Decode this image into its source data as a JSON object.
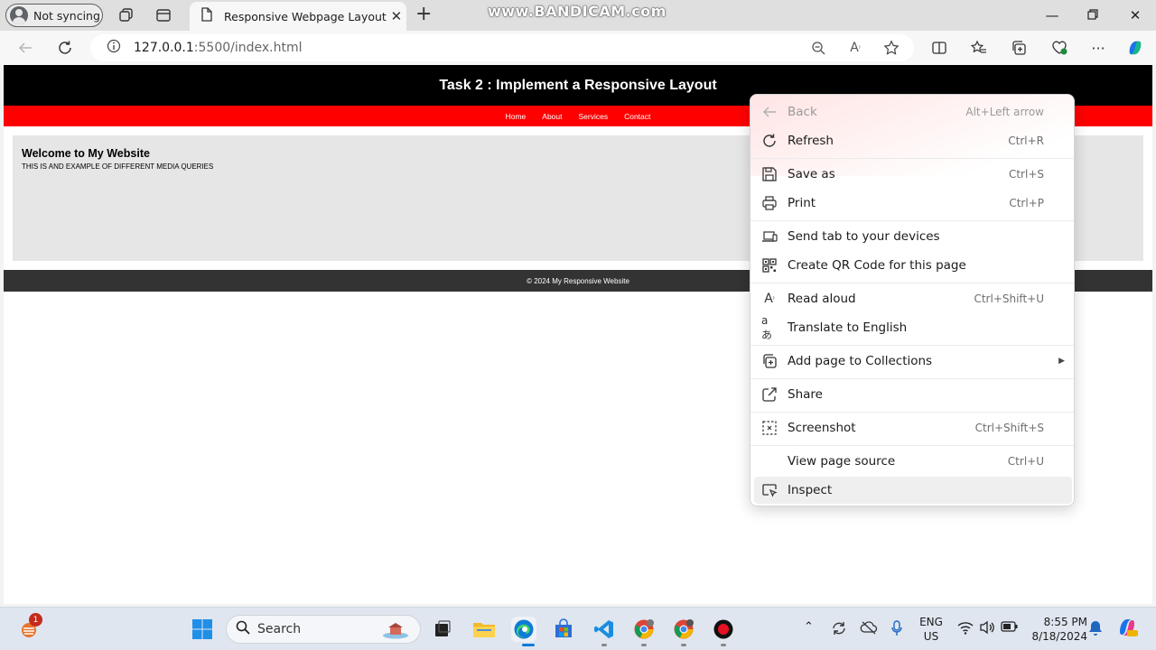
{
  "browser": {
    "profile_label": "Not syncing",
    "tab_title": "Responsive Webpage Layout",
    "watermark": "www.BANDICAM.com",
    "url_host": "127.0.0.1",
    "url_path": ":5500/index.html"
  },
  "page": {
    "header_title": "Task 2 : Implement a Responsive Layout",
    "nav": [
      "Home",
      "About",
      "Services",
      "Contact"
    ],
    "main_heading": "Welcome to My Website",
    "main_text": "THIS IS AND EXAMPLE OF DIFFERENT MEDIA QUERIES",
    "footer_text": "© 2024 My Responsive Website"
  },
  "context_menu": {
    "items": [
      {
        "label": "Back",
        "shortcut": "Alt+Left arrow",
        "icon": "back-arrow-icon",
        "disabled": true
      },
      {
        "label": "Refresh",
        "shortcut": "Ctrl+R",
        "icon": "refresh-icon"
      },
      {
        "label": "Save as",
        "shortcut": "Ctrl+S",
        "icon": "save-icon"
      },
      {
        "label": "Print",
        "shortcut": "Ctrl+P",
        "icon": "printer-icon"
      },
      {
        "label": "Send tab to your devices",
        "shortcut": "",
        "icon": "devices-icon"
      },
      {
        "label": "Create QR Code for this page",
        "shortcut": "",
        "icon": "qr-code-icon"
      },
      {
        "label": "Read aloud",
        "shortcut": "Ctrl+Shift+U",
        "icon": "read-aloud-icon"
      },
      {
        "label": "Translate to English",
        "shortcut": "",
        "icon": "translate-icon"
      },
      {
        "label": "Add page to Collections",
        "shortcut": "",
        "icon": "collections-icon",
        "submenu": true
      },
      {
        "label": "Share",
        "shortcut": "",
        "icon": "share-icon"
      },
      {
        "label": "Screenshot",
        "shortcut": "Ctrl+Shift+S",
        "icon": "screenshot-icon"
      },
      {
        "label": "View page source",
        "shortcut": "Ctrl+U",
        "icon": ""
      },
      {
        "label": "Inspect",
        "shortcut": "",
        "icon": "inspect-icon",
        "highlighted": true
      }
    ]
  },
  "taskbar": {
    "search_placeholder": "Search",
    "notification_badge": "1",
    "language_line1": "ENG",
    "language_line2": "US",
    "time": "8:55 PM",
    "date": "8/18/2024"
  },
  "colors": {
    "site_header": "#000000",
    "site_nav": "#ff0000",
    "site_main": "#e6e6e6",
    "site_footer": "#333333",
    "edge_blue": "#0078d4"
  }
}
